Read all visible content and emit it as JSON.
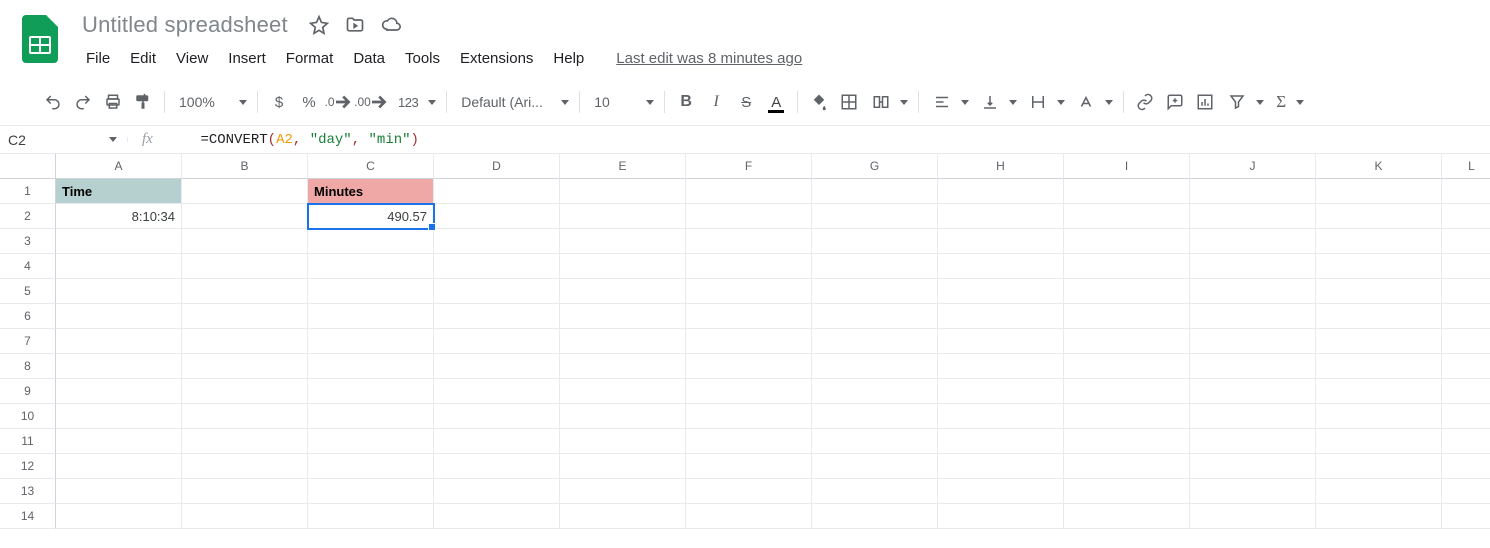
{
  "header": {
    "doc_title": "Untitled spreadsheet",
    "last_edit": "Last edit was 8 minutes ago"
  },
  "menu": {
    "file": "File",
    "edit": "Edit",
    "view": "View",
    "insert": "Insert",
    "format": "Format",
    "data": "Data",
    "tools": "Tools",
    "extensions": "Extensions",
    "help": "Help"
  },
  "toolbar": {
    "zoom": "100%",
    "currency": "$",
    "percent": "%",
    "dec_dec": ".0",
    "inc_dec": ".00",
    "num_format": "123",
    "font": "Default (Ari...",
    "font_size": "10"
  },
  "formula_bar": {
    "name_box": "C2",
    "fx_label": "fx",
    "formula_eq": "=",
    "formula_fn": "CONVERT",
    "formula_lp": "(",
    "formula_ref": "A2",
    "formula_c1": ", ",
    "formula_s1": "\"day\"",
    "formula_c2": ", ",
    "formula_s2": "\"min\"",
    "formula_rp": ")"
  },
  "columns": [
    "A",
    "B",
    "C",
    "D",
    "E",
    "F",
    "G",
    "H",
    "I",
    "J",
    "K",
    "L"
  ],
  "rows": [
    "1",
    "2",
    "3",
    "4",
    "5",
    "6",
    "7",
    "8",
    "9",
    "10",
    "11",
    "12",
    "13",
    "14"
  ],
  "cells": {
    "A1": "Time",
    "C1": "Minutes",
    "A2": "8:10:34",
    "C2": "490.57"
  },
  "selection": "C2"
}
